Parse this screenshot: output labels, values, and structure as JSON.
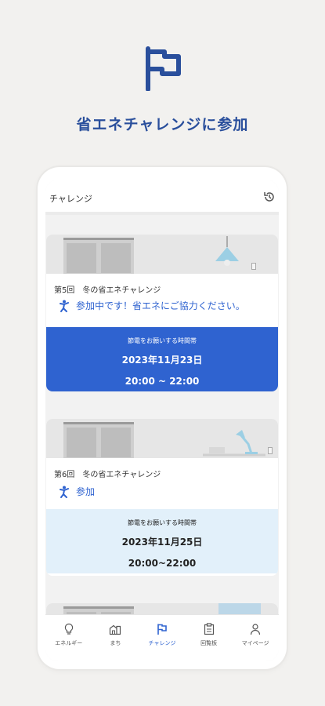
{
  "hero": {
    "title": "省エネチャレンジに参加",
    "icon": "flag-icon",
    "color": "#2a4f9c"
  },
  "appbar": {
    "title": "チャレンジ",
    "icon": "history-icon"
  },
  "challenges": [
    {
      "meta": "第5回　冬の省エネチャレンジ",
      "status": "参加中です！省エネにご協力ください。",
      "time_label": "節電をお願いする時間帯",
      "date": "2023年11月23日",
      "time": "20:00 ~ 22:00",
      "style": "active"
    },
    {
      "meta": "第6回　冬の省エネチャレンジ",
      "status": "参加",
      "time_label": "節電をお願いする時間帯",
      "date": "2023年11月25日",
      "time": "20:00~22:00",
      "style": "upcoming"
    }
  ],
  "tabs": [
    {
      "label": "エネルギー",
      "icon": "lightbulb-icon"
    },
    {
      "label": "まち",
      "icon": "town-icon"
    },
    {
      "label": "チャレンジ",
      "icon": "flag-icon",
      "active": true
    },
    {
      "label": "回覧板",
      "icon": "clipboard-icon"
    },
    {
      "label": "マイページ",
      "icon": "person-icon"
    }
  ],
  "colors": {
    "accent": "#2f63d0",
    "active_box": "#2f63d0",
    "upcoming_box": "#e2f0fa"
  }
}
